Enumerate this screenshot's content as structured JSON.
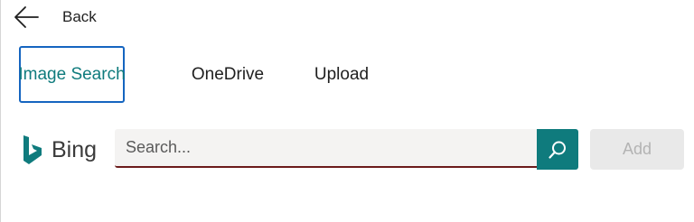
{
  "nav": {
    "back_label": "Back",
    "back_icon": "back-arrow-icon"
  },
  "tabs": [
    {
      "label": "Image Search",
      "active": true
    },
    {
      "label": "OneDrive",
      "active": false
    },
    {
      "label": "Upload",
      "active": false
    }
  ],
  "provider": {
    "name": "Bing",
    "logo_icon": "bing-logo-icon",
    "logo_color": "#0f7b7d"
  },
  "search": {
    "placeholder": "Search...",
    "value": "",
    "button_icon": "search-icon"
  },
  "add": {
    "label": "Add",
    "enabled": false
  },
  "colors": {
    "accent": "#0f7b7d",
    "focus_border": "#1565c0",
    "input_underline": "#6b1b1b",
    "disabled_bg": "#e9e9e9",
    "disabled_text": "#b3b3b3"
  }
}
